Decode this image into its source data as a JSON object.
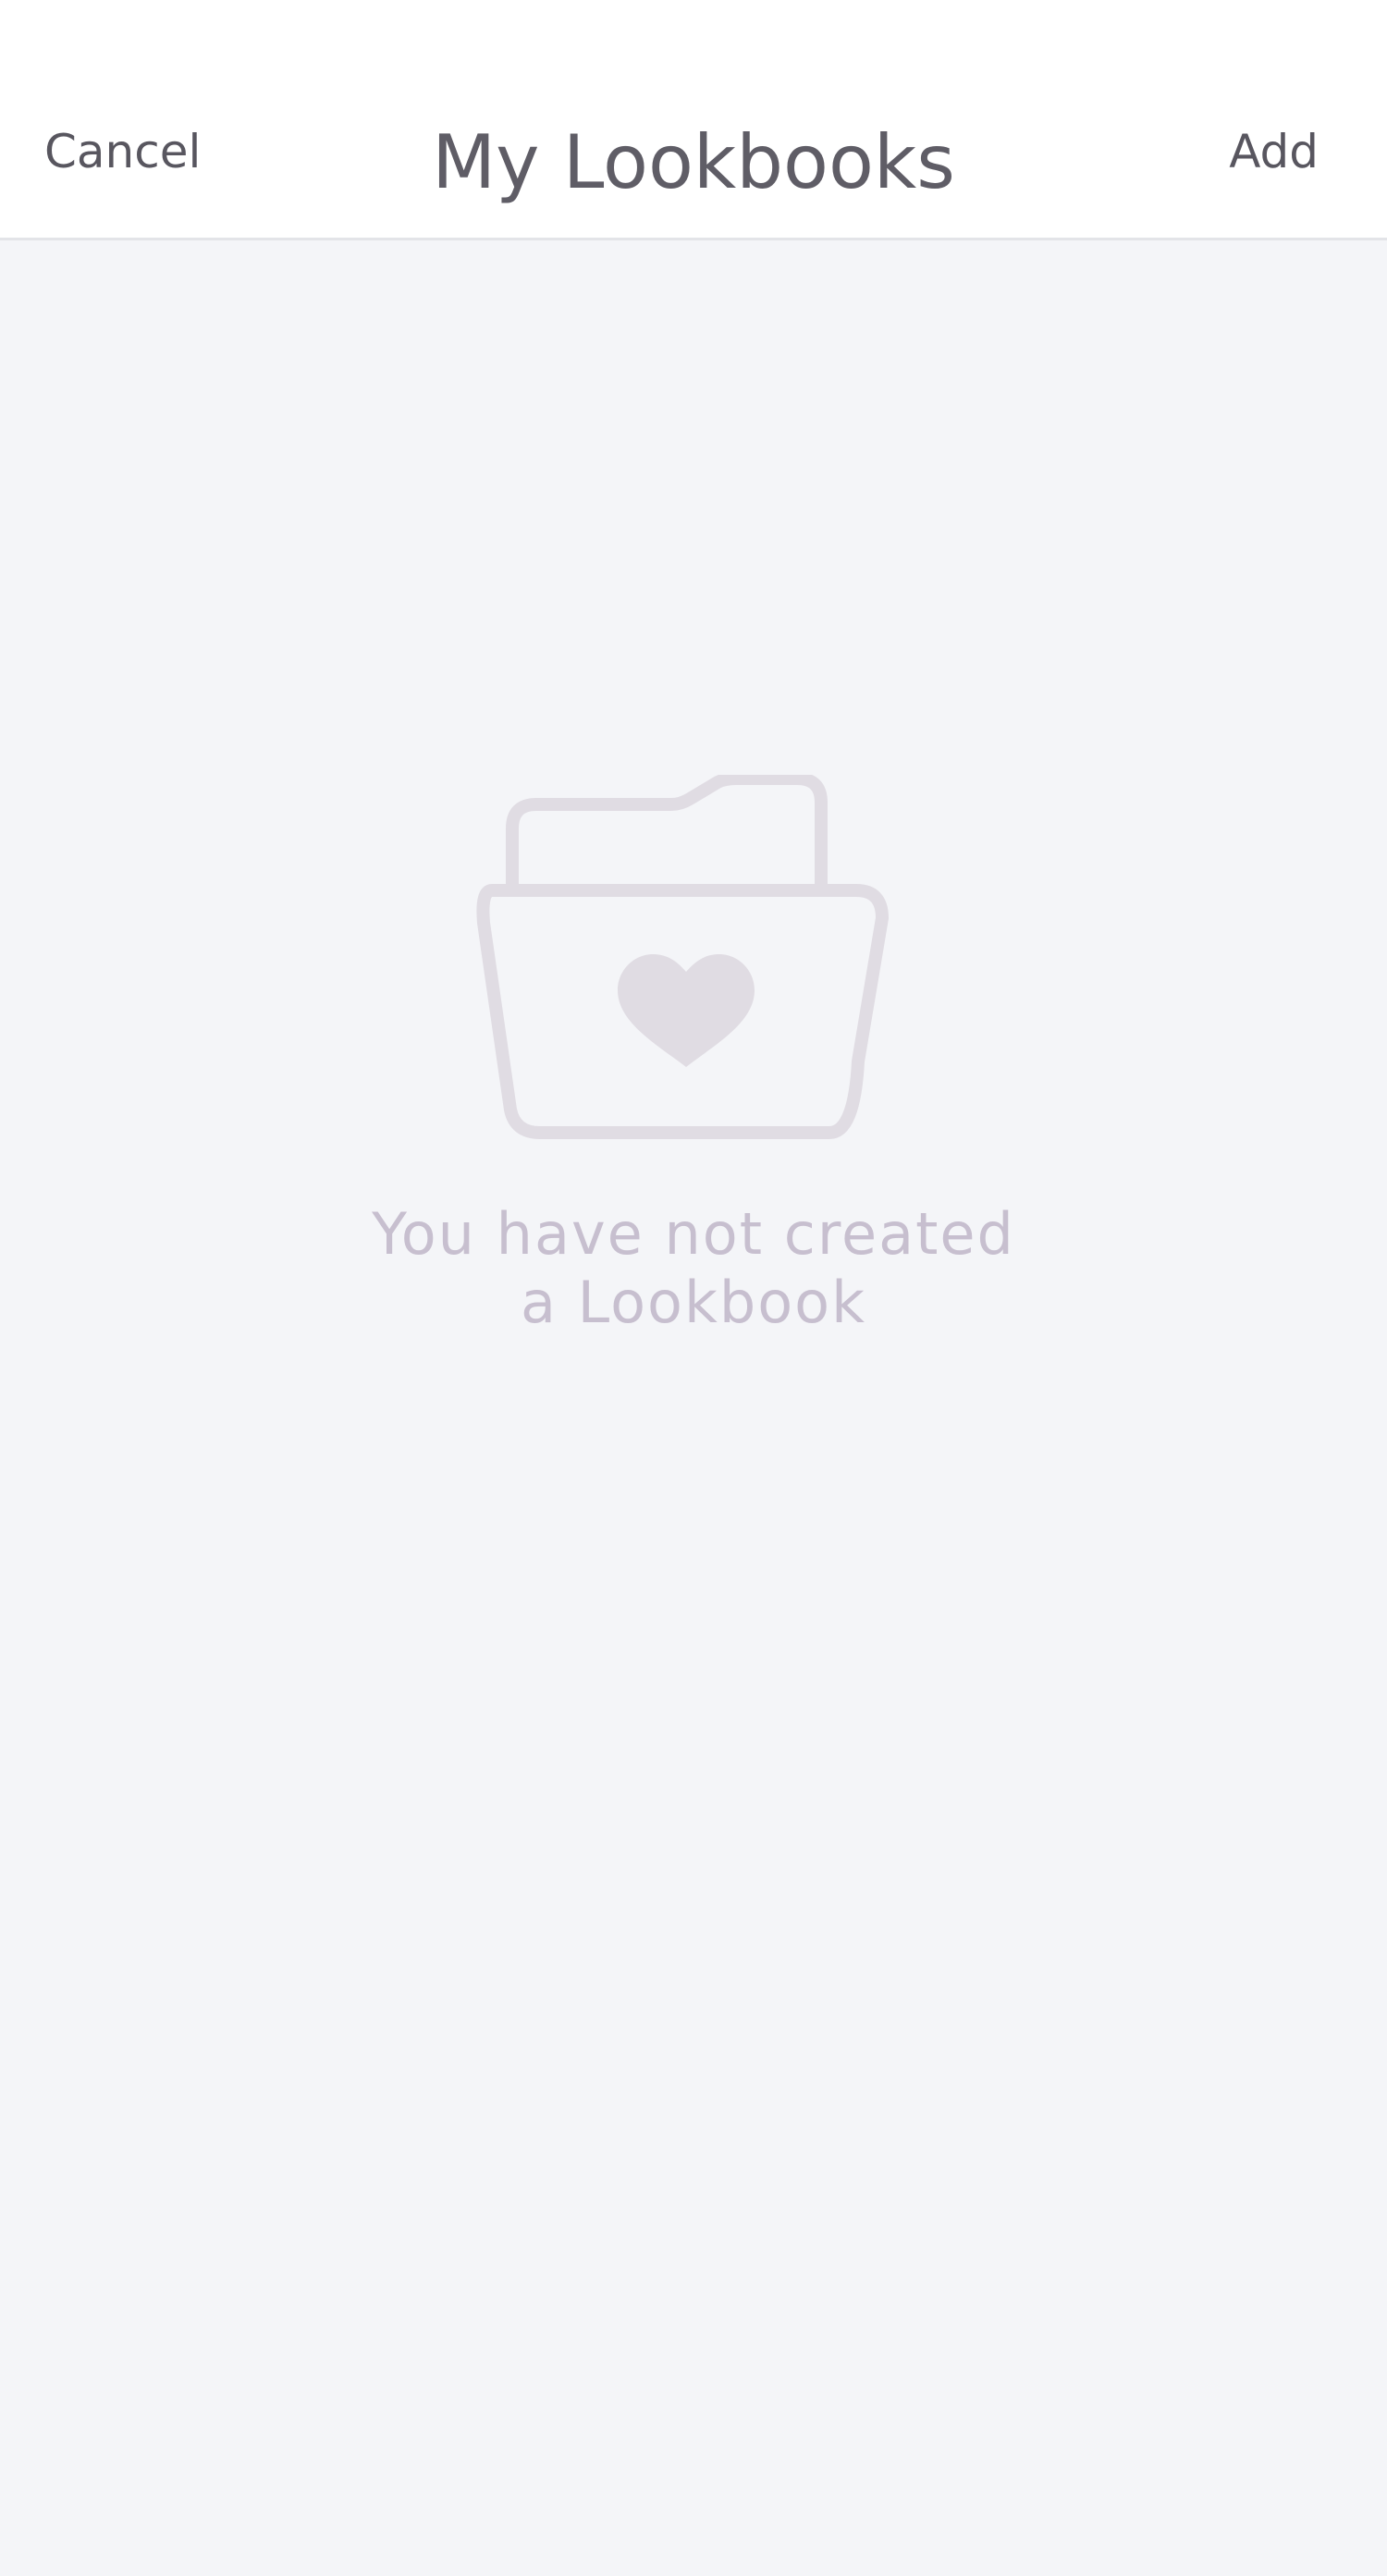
{
  "header": {
    "cancel_label": "Cancel",
    "title": "My Lookbooks",
    "add_label": "Add"
  },
  "empty_state": {
    "icon": "folder-heart-icon",
    "message_line1": "You have not created",
    "message_line2": "a Lookbook"
  },
  "colors": {
    "header_bg": "#ffffff",
    "page_bg": "#f4f5f8",
    "header_text": "#58565f",
    "icon": "#e0dce3",
    "empty_text": "#c7bfcf"
  }
}
